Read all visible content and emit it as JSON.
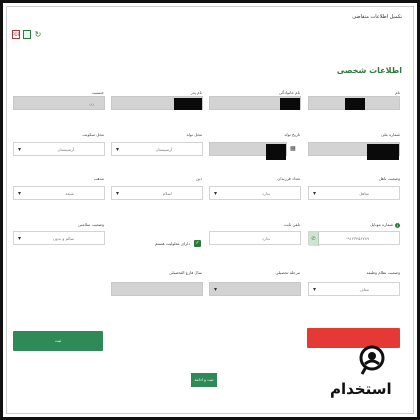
{
  "page": {
    "title": "تکمیل اطلاعات متقاضی"
  },
  "toolbar": {
    "pdf_icon": "pdf-icon",
    "sheet_icon": "spreadsheet-icon",
    "refresh_icon": "refresh-icon",
    "pdf_label": "PDF"
  },
  "section": {
    "title": "اطلاعات شخصی"
  },
  "fields": {
    "first_name": {
      "label": "نام",
      "value": ""
    },
    "last_name": {
      "label": "نام خانوادگی",
      "value": ""
    },
    "father_name": {
      "label": "نام پدر",
      "value": ""
    },
    "gender": {
      "label": "جنسیت",
      "value": "زن"
    },
    "national_id": {
      "label": "شماره ملی",
      "value": ""
    },
    "birth_date": {
      "label": "تاریخ تولد",
      "value": ""
    },
    "birth_place": {
      "label": "محل تولد",
      "value": "آرمنیستان"
    },
    "residence": {
      "label": "محل سکونت",
      "value": "آرمنیستان"
    },
    "marital": {
      "label": "وضعیت تاهل",
      "value": "متاهل"
    },
    "children": {
      "label": "تعداد فرزندان",
      "value": "ندارد"
    },
    "religion": {
      "label": "دین",
      "value": "اسلام"
    },
    "sect": {
      "label": "مذهب",
      "value": "شیعه"
    },
    "mobile": {
      "label": "شماره موبایل",
      "value": "۰۹۱۲۳۴۵۶۷۸۹"
    },
    "phone": {
      "label": "تلفن ثابت",
      "value": "ندارد"
    },
    "disability_check": {
      "label": "دارای معلولیت هستم"
    },
    "health": {
      "label": "وضعیت سلامتی",
      "value": "سالم و بدون"
    },
    "military": {
      "label": "وضعیت نظام وظیفه",
      "value": "معاف"
    },
    "education": {
      "label": "مرحله تحصیلی",
      "value": ""
    },
    "grad_year": {
      "label": "سال فارغ التحصیلی",
      "value": ""
    }
  },
  "buttons": {
    "save_label": "ثبت",
    "back_label": "ثبت و ادامه"
  },
  "brand": {
    "name": "استخدام"
  },
  "colors": {
    "accent": "#2c7a3d",
    "danger": "#e53935",
    "button_green": "#2e8b57",
    "disabled": "#d3d3d3"
  }
}
